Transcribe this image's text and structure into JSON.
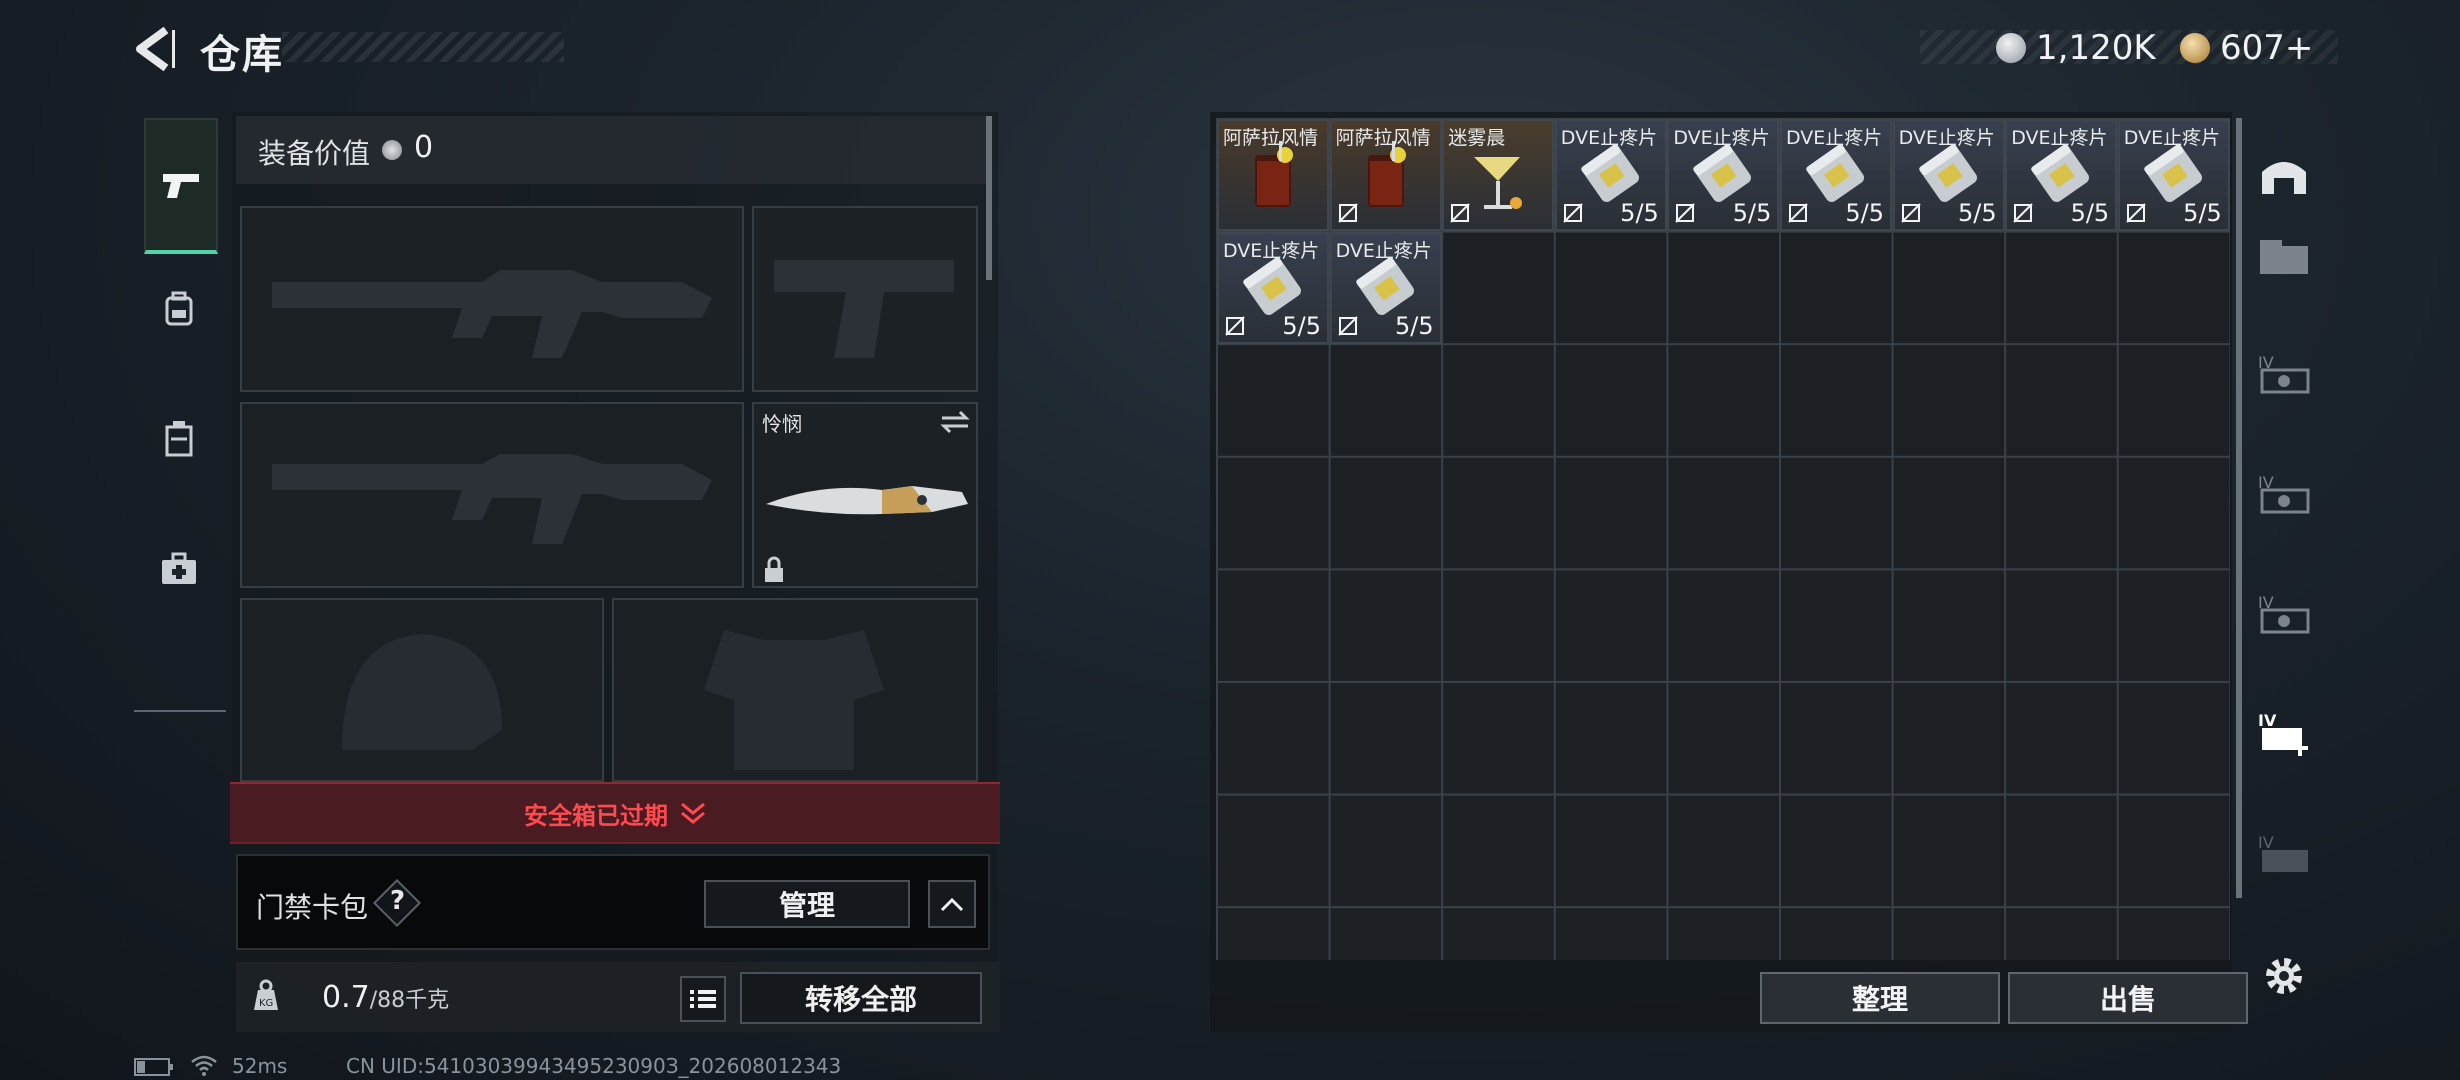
{
  "header": {
    "title": "仓库",
    "silver": "1,120K",
    "gold": "607+",
    "silver_color": "#cfd3d6",
    "gold_color": "#d6a850"
  },
  "sidenav": {
    "tabs": [
      {
        "icon": "pistol-icon",
        "active": true
      },
      {
        "icon": "backpack-icon"
      },
      {
        "icon": "vest-icon"
      },
      {
        "icon": "medkit-icon"
      }
    ]
  },
  "equipment": {
    "value_label": "装备价值",
    "value": "0",
    "melee_name": "怜悯"
  },
  "safe_box": {
    "status": "安全箱已过期"
  },
  "card_pack": {
    "label": "门禁卡包",
    "help": "?",
    "manage": "管理"
  },
  "weight": {
    "current": "0.7",
    "max": "/88千克"
  },
  "transfer_all": "转移全部",
  "stash": {
    "items": [
      {
        "name": "阿萨拉风情",
        "type": "drink",
        "count": "",
        "tradeable": true
      },
      {
        "name": "阿萨拉风情",
        "type": "drink",
        "count": "",
        "tradeable": false
      },
      {
        "name": "迷雾晨",
        "type": "cocktail",
        "count": "",
        "tradeable": false
      },
      {
        "name": "DVE止疼片",
        "type": "pills",
        "count": "5/5",
        "tradeable": false
      },
      {
        "name": "DVE止疼片",
        "type": "pills",
        "count": "5/5",
        "tradeable": false
      },
      {
        "name": "DVE止疼片",
        "type": "pills",
        "count": "5/5",
        "tradeable": false
      },
      {
        "name": "DVE止疼片",
        "type": "pills",
        "count": "5/5",
        "tradeable": false
      },
      {
        "name": "DVE止疼片",
        "type": "pills",
        "count": "5/5",
        "tradeable": false
      },
      {
        "name": "DVE止疼片",
        "type": "pills",
        "count": "5/5",
        "tradeable": false
      },
      {
        "name": "DVE止疼片",
        "type": "pills",
        "count": "5/5",
        "tradeable": false
      },
      {
        "name": "DVE止疼片",
        "type": "pills",
        "count": "5/5",
        "tradeable": false
      }
    ],
    "sort_button": "整理",
    "sell_button": "出售"
  },
  "right_nav": {
    "tabs": [
      "warehouse-home-icon",
      "stash-expansion-icon",
      "stash-iv-1-icon",
      "stash-iv-2-icon",
      "stash-iv-3-icon",
      "stash-iv-add-icon",
      "stash-iv-folder-icon",
      "settings-icon"
    ]
  },
  "status_bar": {
    "ping": "52ms",
    "uid": "CN UID:5410303994349523090З_202608012343"
  }
}
